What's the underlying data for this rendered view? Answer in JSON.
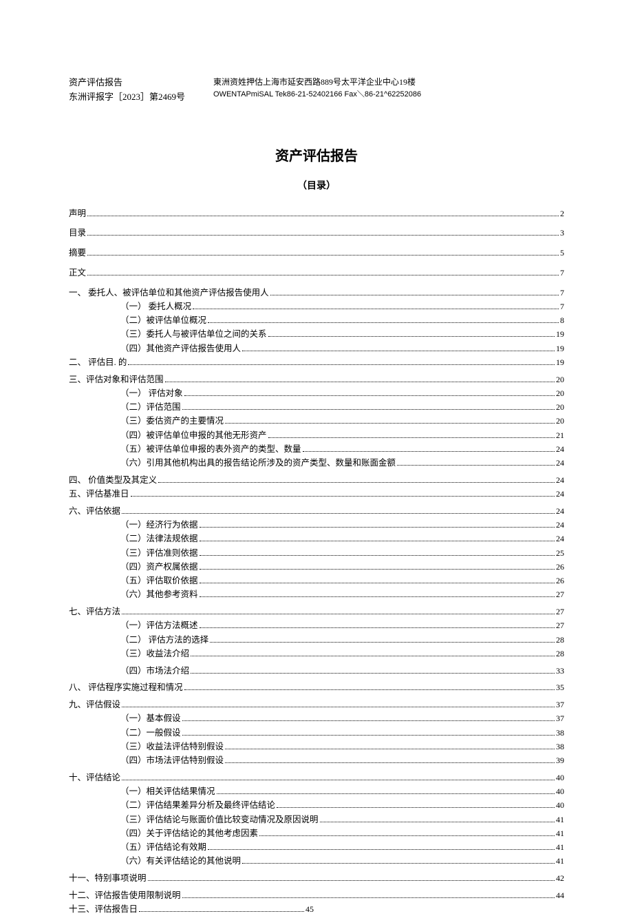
{
  "header": {
    "left_line1": "资产评估报告",
    "left_line2": "东洲评报字［2023］第2469号",
    "right_line1": "東洲资姓押估上海市延安西路889号太平洋企业中心19楼",
    "right_line2": "OWENTAPmiSAL Tek86-21-52402166 Fax＼86-21^62252086"
  },
  "title": "资产评估报告",
  "subtitle": "（目录）",
  "toc": [
    {
      "label": "声明",
      "page": "2",
      "indent": 1,
      "spaced": true
    },
    {
      "label": "目录",
      "page": "3",
      "indent": 1,
      "spaced": true
    },
    {
      "label": "摘要",
      "page": "5",
      "indent": 1,
      "spaced": true
    },
    {
      "label": "正文",
      "page": "7",
      "indent": 1,
      "spaced": true
    },
    {
      "label": "一、 委托人、被评估单位和其他资产评估报告使用人",
      "page": "7",
      "indent": 1,
      "spaced": true
    },
    {
      "label": "（一） 委托人概况",
      "page": "7",
      "indent": 2
    },
    {
      "label": "（二）被评估单位概况",
      "page": "8",
      "indent": 2
    },
    {
      "label": "（三）委托人与被评估单位之间的关系",
      "page": "19",
      "indent": 2
    },
    {
      "label": "（四）其他资产评估报告使用人",
      "page": "19",
      "indent": 2
    },
    {
      "label": "二、  评估目. 的",
      "page": "19",
      "indent": 1
    },
    {
      "label": "三、评估对象和评估范围",
      "page": "20",
      "indent": 1,
      "spaced_small": true
    },
    {
      "label": "（一） 评估对象",
      "page": "20",
      "indent": 2
    },
    {
      "label": "（二）评估范围",
      "page": "20",
      "indent": 2
    },
    {
      "label": "（三）委估资产的主要情况",
      "page": "20",
      "indent": 2
    },
    {
      "label": "（四）被评估单位申报的其他无形资产",
      "page": "21",
      "indent": 2
    },
    {
      "label": "（五）被评估单位申报的表外资产的类型、数量",
      "page": "24",
      "indent": 2
    },
    {
      "label": "（六）引用其他机构出具的报告结论所涉及的资产类型、数量和账面金额",
      "page": "24",
      "indent": 2
    },
    {
      "label": "四、 价值类型及其定义",
      "page": "24",
      "indent": 1,
      "spaced_small": true
    },
    {
      "label": "五、评估基准日",
      "page": "24",
      "indent": 1
    },
    {
      "label": "六、评估依据",
      "page": "24",
      "indent": 1,
      "spaced_small": true
    },
    {
      "label": "（一）经济行为依据",
      "page": "24",
      "indent": 2
    },
    {
      "label": "（二）法律法规依据",
      "page": "24",
      "indent": 2
    },
    {
      "label": "（三）评估准则依据",
      "page": "25",
      "indent": 2
    },
    {
      "label": "（四）资产权属依据",
      "page": "26",
      "indent": 2
    },
    {
      "label": "（五）评估取价依据",
      "page": "26",
      "indent": 2
    },
    {
      "label": "（六）其他参考资料",
      "page": "27",
      "indent": 2
    },
    {
      "label": "七、评估方法",
      "page": "27",
      "indent": 1,
      "spaced_small": true
    },
    {
      "label": "（一）评估方法概述",
      "page": "27",
      "indent": 2
    },
    {
      "label": "（二） 评估方法的选择",
      "page": "28",
      "indent": 2
    },
    {
      "label": "（三）收益法介绍",
      "page": "28",
      "indent": 2
    },
    {
      "label": "（四）市场法介绍",
      "page": "33",
      "indent": 2,
      "spaced_small": true
    },
    {
      "label": "八、  评估程序实施过程和情况",
      "page": "35",
      "indent": 1,
      "spaced_small": true
    },
    {
      "label": "九、评估假设",
      "page": "37",
      "indent": 1,
      "spaced_small": true
    },
    {
      "label": "（一）基本假设",
      "page": "37",
      "indent": 2
    },
    {
      "label": "（二）一般假设",
      "page": "38",
      "indent": 2
    },
    {
      "label": "（三）收益法评估特别假设",
      "page": "38",
      "indent": 2
    },
    {
      "label": "（四）市场法评估特别假设",
      "page": "39",
      "indent": 2
    },
    {
      "label": "十、评估结论",
      "page": "40",
      "indent": 1,
      "spaced_small": true
    },
    {
      "label": "（一）相关评估结果情况",
      "page": "40",
      "indent": 2
    },
    {
      "label": "（二）评估结果差异分析及最终评估结论",
      "page": "40",
      "indent": 2
    },
    {
      "label": "（三）评估结论与账面价值比较变动情况及原因说明",
      "page": "41",
      "indent": 2
    },
    {
      "label": "（四）关于评估结论的其他考虑因素",
      "page": "41",
      "indent": 2
    },
    {
      "label": "（五）评估结论有效期",
      "page": "41",
      "indent": 2
    },
    {
      "label": "（六）有关评估结论的其他说明",
      "page": "41",
      "indent": 2
    },
    {
      "label": "十一、特别事项说明",
      "page": "42",
      "indent": 1,
      "spaced_small": true
    },
    {
      "label": "十二、评估报告使用限制说明",
      "page": "44",
      "indent": 1,
      "spaced_small": true
    },
    {
      "label": "十三、评估报告日",
      "page": "45",
      "indent": 1,
      "short": true
    }
  ]
}
